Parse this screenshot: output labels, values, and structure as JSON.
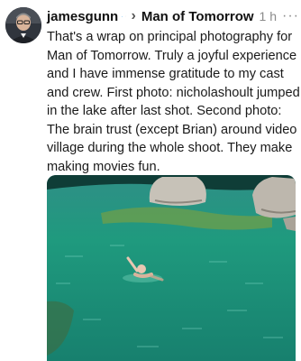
{
  "post": {
    "username": "jamesgunn",
    "community": "Man of Tomorrow",
    "time": "1 h",
    "body": "That's a wrap on principal photography for Man of Tomorrow. Truly a joyful experience and I have immense gratitude to my cast and crew. First photo: nicholashoult jumped in the lake after last shot. Second photo: The brain trust (except Brian) around video village during the whole shoot. They make making movies fun."
  },
  "icons": {
    "verified": "verified-badge-icon",
    "thread": "thread-circle-icon",
    "chevron": "chevron-right-icon",
    "more": "more-options-icon"
  },
  "colors": {
    "verified": "#1d9bf0",
    "water": "#1f9a7e"
  }
}
